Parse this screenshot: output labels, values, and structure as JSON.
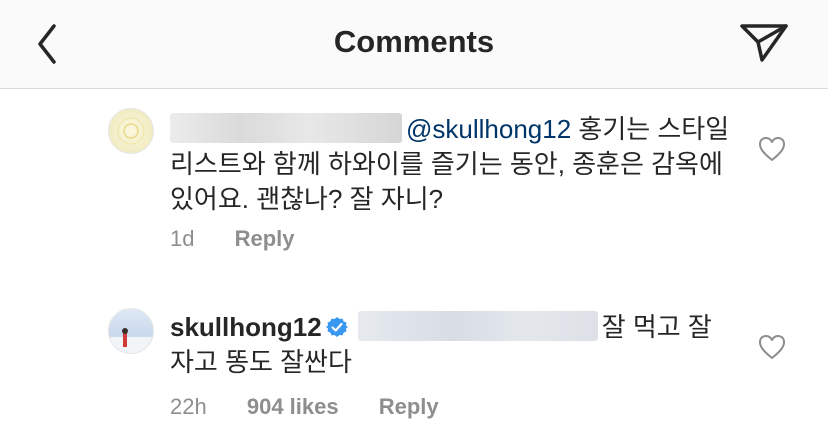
{
  "header": {
    "title": "Comments",
    "back_icon": "chevron-left-icon",
    "send_icon": "paper-plane-icon"
  },
  "comments": [
    {
      "username_hidden": true,
      "mention": "@skullhong12",
      "text": " 홍기는 스타일리스트와 함께 하와이를 즐기는 동안, 종훈은 감옥에 있어요. 괜찮나? 잘 자니?",
      "time": "1d",
      "reply_label": "Reply"
    },
    {
      "username": "skullhong12",
      "verified": true,
      "text": "잘 먹고 잘 자고 똥도 잘싼다",
      "time": "22h",
      "likes": "904 likes",
      "reply_label": "Reply"
    }
  ],
  "colors": {
    "text": "#262626",
    "mention": "#003569",
    "meta": "#8e8e8e",
    "verified": "#3897f0"
  }
}
